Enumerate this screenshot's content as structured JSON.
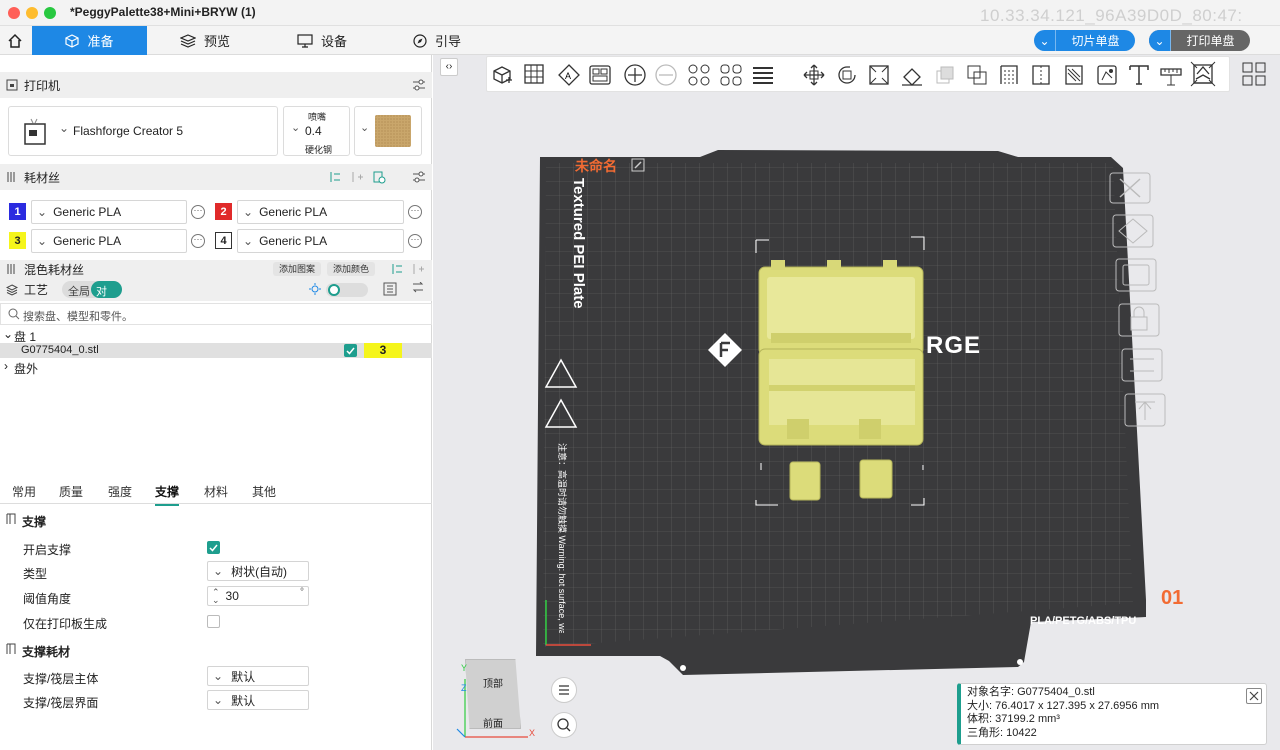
{
  "window": {
    "title": "*PeggyPalette38+Mini+BRYW (1)",
    "ip_text": "10.33.34.121_96A39D0D_80:47:"
  },
  "tabs": [
    {
      "label": "准备"
    },
    {
      "label": "预览"
    },
    {
      "label": "设备"
    },
    {
      "label": "引导"
    }
  ],
  "actions": {
    "slice": "切片单盘",
    "print": "打印单盘"
  },
  "printer": {
    "section": "打印机",
    "name": "Flashforge Creator 5",
    "nozzle_label": "喷嘴",
    "nozzle_value": "0.4",
    "nozzle_material": "硬化钢"
  },
  "filament": {
    "section": "耗材丝",
    "items": [
      {
        "num": "1",
        "name": "Generic PLA",
        "color": "#2b2be0"
      },
      {
        "num": "2",
        "name": "Generic PLA",
        "color": "#e02a2a"
      },
      {
        "num": "3",
        "name": "Generic PLA",
        "color": "#f5f51b"
      },
      {
        "num": "4",
        "name": "Generic PLA",
        "color": "#ffffff"
      }
    ]
  },
  "mixed": {
    "section": "混色耗材丝",
    "add_pattern": "添加图案",
    "add_color": "添加颜色"
  },
  "process": {
    "section": "工艺",
    "toggle_global": "全局",
    "toggle_object": "对象"
  },
  "search": {
    "placeholder": "搜索盘、模型和零件。"
  },
  "tree": {
    "plate": "盘 1",
    "object": "G0775404_0.stl",
    "object_filament": "3",
    "outside": "盘外"
  },
  "param_tabs": [
    "常用",
    "质量",
    "强度",
    "支撑",
    "材料",
    "其他"
  ],
  "support": {
    "section": "支撑",
    "enable_label": "开启支撑",
    "type_label": "类型",
    "type_value": "树状(自动)",
    "angle_label": "阈值角度",
    "angle_value": "30",
    "angle_unit": "°",
    "build_plate_only": "仅在打印板生成"
  },
  "support_filament": {
    "section": "支撑耗材",
    "base_label": "支撑/筏层主体",
    "base_value": "默认",
    "interface_label": "支撑/筏层界面",
    "interface_value": "默认"
  },
  "plate": {
    "name": "未命名",
    "label": "Textured PEI Plate",
    "warning": "注意：高温时请勿触摸 Warning: hot surface, wait until cool",
    "materials": "PLA/PETG/ABS/TPU",
    "index": "01",
    "brand": "RGE"
  },
  "view_cube": {
    "top": "顶部",
    "front": "前面",
    "axis_x": "X",
    "axis_y": "Y",
    "axis_z": "Z"
  },
  "object_info": {
    "name_label": "对象名字:",
    "name_value": "G0775404_0.stl",
    "size_label": "大小:",
    "size_value": "76.4017 x 127.395 x 27.6956 mm",
    "volume_label": "体积:",
    "volume_value": "37199.2 mm³",
    "triangles_label": "三角形:",
    "triangles_value": "10422"
  },
  "colors": {
    "accent": "#1e88e5",
    "teal": "#1e9e8e",
    "plate": "#3a3a3c",
    "model": "#e6e58a",
    "plate_name": "#f26b33"
  }
}
